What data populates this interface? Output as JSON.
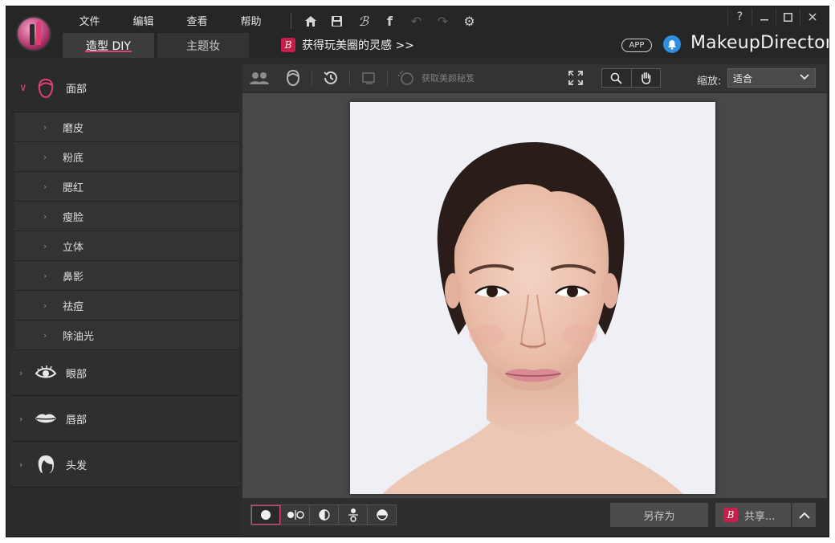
{
  "window": {
    "menu": [
      "文件",
      "编辑",
      "查看",
      "帮助"
    ],
    "tabs": [
      {
        "label": "造型 DIY",
        "active": true
      },
      {
        "label": "主题妆",
        "active": false
      }
    ],
    "promo_badge": "B",
    "promo_text": "获得玩美圈的灵感 >>",
    "app_pill": "APP",
    "brand": "MakeupDirector",
    "help_label": "?"
  },
  "sidebar": {
    "categories": [
      {
        "label": "面部",
        "open": true,
        "icon": "face-icon",
        "items": [
          "磨皮",
          "粉底",
          "腮红",
          "瘦脸",
          "立体",
          "鼻影",
          "祛痘",
          "除油光"
        ]
      },
      {
        "label": "眼部",
        "open": false,
        "icon": "eye-icon"
      },
      {
        "label": "唇部",
        "open": false,
        "icon": "lips-icon"
      },
      {
        "label": "头发",
        "open": false,
        "icon": "hair-icon"
      }
    ]
  },
  "toolbar": {
    "beauty_tip": "获取美颜秘笈",
    "zoom_label": "缩放:",
    "zoom_value": "适合"
  },
  "bottombar": {
    "save_as": "另存为",
    "share": "共享...",
    "share_badge": "B"
  },
  "colors": {
    "accent": "#e0407a",
    "bell": "#2e8fe0",
    "badge": "#c81e4a"
  }
}
